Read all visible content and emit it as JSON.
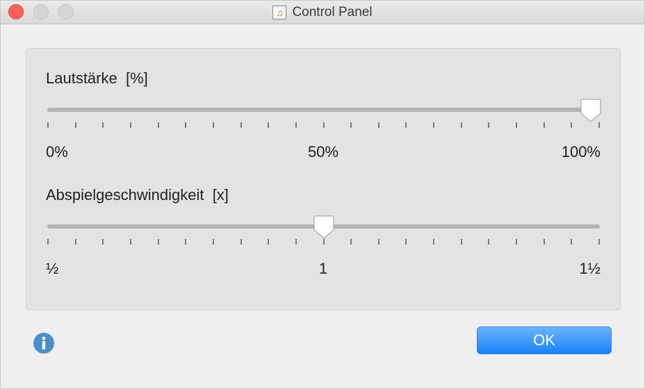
{
  "window": {
    "title": "Control Panel",
    "app_icon": "music-note-icon"
  },
  "sliders": [
    {
      "label": "Lautstärke  [%]",
      "value_fraction": 1.0,
      "tick_count": 21,
      "scale_labels": [
        "0%",
        "50%",
        "100%"
      ]
    },
    {
      "label": "Abspielgeschwindigkeit  [x]",
      "value_fraction": 0.5,
      "tick_count": 21,
      "scale_labels": [
        "½",
        "1",
        "1½"
      ]
    }
  ],
  "buttons": {
    "ok_label": "OK"
  },
  "icons": {
    "info": "info-icon"
  },
  "colors": {
    "accent": "#1a82fb",
    "close": "#fc5f57",
    "info": "#4a8fc9"
  }
}
